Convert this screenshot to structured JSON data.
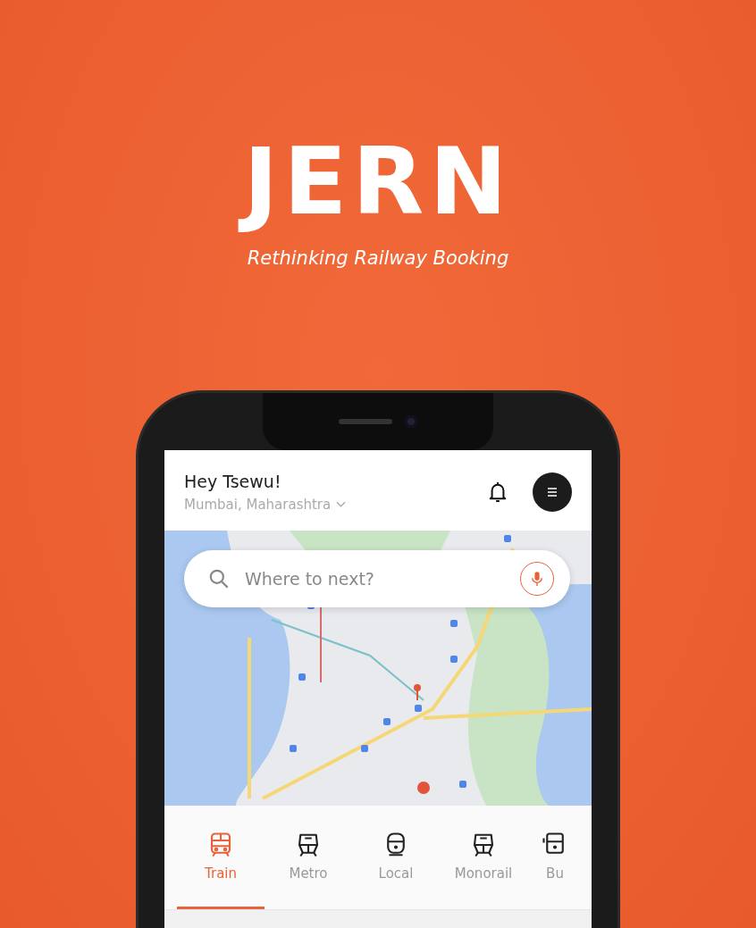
{
  "brand": {
    "logo": "JERN",
    "tagline": "Rethinking Railway Booking"
  },
  "header": {
    "greeting": "Hey Tsewu!",
    "location": "Mumbai, Maharashtra"
  },
  "search": {
    "placeholder": "Where to next?"
  },
  "tabs": [
    {
      "label": "Train",
      "kind": "train",
      "selected": true
    },
    {
      "label": "Metro",
      "kind": "metro",
      "selected": false
    },
    {
      "label": "Local",
      "kind": "local",
      "selected": false
    },
    {
      "label": "Monorail",
      "kind": "metro",
      "selected": false
    },
    {
      "label": "Bu",
      "kind": "bus",
      "selected": false
    }
  ]
}
